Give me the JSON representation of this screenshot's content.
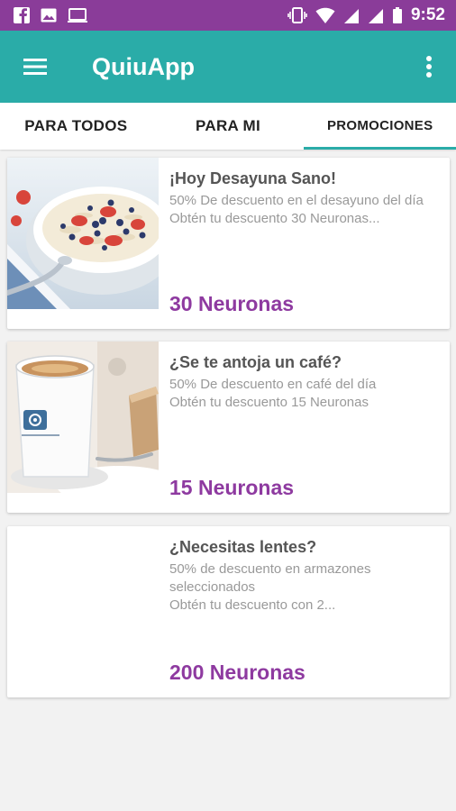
{
  "status_bar": {
    "time": "9:52",
    "left_icons": [
      "facebook-icon",
      "image-icon",
      "laptop-icon"
    ],
    "right_icons": [
      "vibrate-icon",
      "wifi-icon",
      "signal-icon",
      "signal-icon",
      "battery-icon"
    ]
  },
  "app_bar": {
    "title": "QuiuApp",
    "menu_icon": "hamburger-menu-icon",
    "overflow_icon": "more-vert-icon"
  },
  "tabs": [
    {
      "label": "PARA TODOS",
      "active": false
    },
    {
      "label": "PARA MI",
      "active": false
    },
    {
      "label": "PROMOCIONES",
      "active": true
    }
  ],
  "promotions": [
    {
      "title": "¡Hoy Desayuna Sano!",
      "description": "50% De descuento en el desayuno del día\nObtén tu descuento 30 Neuronas...",
      "points": "30 Neuronas",
      "image": "breakfast-bowl-image"
    },
    {
      "title": "¿Se te antoja un café?",
      "description": "50% De descuento en café del día\nObtén tu descuento 15 Neuronas",
      "points": "15 Neuronas",
      "image": "coffee-cup-image"
    },
    {
      "title": "¿Necesitas lentes?",
      "description": "50%  de descuento en armazones seleccionados\nObtén tu descuento con  2...",
      "points": "200 Neuronas",
      "image": ""
    }
  ],
  "colors": {
    "status_bar": "#8a3c99",
    "app_bar": "#2aaca8",
    "tab_indicator": "#2aaca8",
    "points_text": "#8e3aa0",
    "background": "#f2f2f2"
  }
}
